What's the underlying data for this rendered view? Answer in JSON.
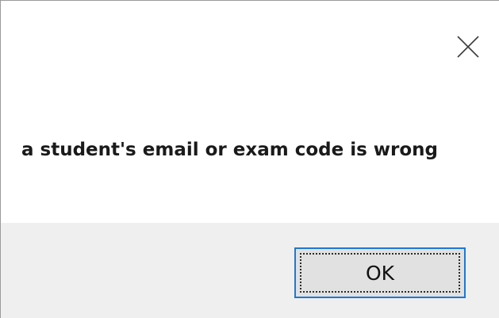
{
  "dialog": {
    "message": "a student's email or exam code is wrong",
    "ok_label": "OK",
    "close_icon": "close-icon"
  },
  "colors": {
    "focus_border": "#1e78d4",
    "footer_bg": "#efefef",
    "button_bg": "#e1e1e1"
  }
}
